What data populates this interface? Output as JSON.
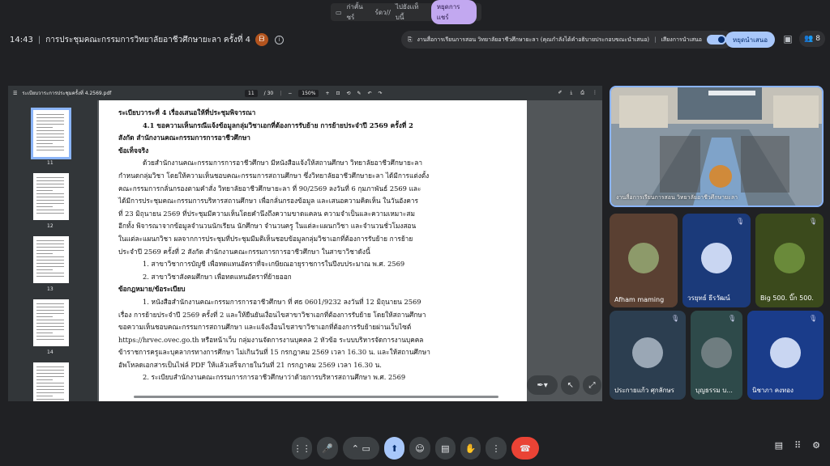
{
  "share_bar": {
    "label1": "ก่าคั้นซร์",
    "label2": "ร์ดว//",
    "label3": "ไปยังเเท็บนี้",
    "stop": "หยุดการแชร์"
  },
  "header": {
    "time": "14:43",
    "separator": "|",
    "title": "การประชุมคณะกรรมการวิทยาลัยอาชีวศึกษายะลา ครั้งที่ 4",
    "rec_glyph": "ᗷ",
    "info_glyph": "i"
  },
  "presenting": {
    "text": "งานสื่อการเรียนการสอน วิทยาลัยอาชีวศึกษายะลา (คุณกำลังได้คำอธิบายประกอบขณะนำเสนอ)",
    "audio_label": "เสียงการนำเสนอ",
    "stop_button": "หยุดนำเสนอ",
    "people_count": "8"
  },
  "pdf": {
    "filename": "ระเบียบวาระการประชุมครั้งที่ 4.2569.pdf",
    "page_current": "11",
    "page_total": "/ 30",
    "zoom": "150%",
    "thumb_labels": [
      "11",
      "12",
      "13",
      "14"
    ],
    "content": [
      {
        "cls": "b",
        "text": "ระเบียบวาระที่  4  เรื่องเสนอให้ที่ประชุมพิจารณา"
      },
      {
        "cls": "b ind",
        "text": "4.1  ขอความเห็นกรณีแจ้งข้อมูลกลุ่มวิชาเอกที่ต้องการรับย้าย การย้ายประจำปี 2569  ครั้งที่ 2"
      },
      {
        "cls": "b",
        "text": "สังกัด สำนักงานคณะกรรมการการอาชีวศึกษา"
      },
      {
        "cls": "b",
        "text": "ข้อเท็จจริง"
      },
      {
        "cls": "ind",
        "text": "ด้วยสำนักงานคณะกรรมการการอาชีวศึกษา มีหนังสือแจ้งให้สถานศึกษา วิทยาลัยอาชีวศึกษายะลา"
      },
      {
        "cls": "",
        "text": "กำหนดกลุ่มวิชา โดยให้ความเห็นชอบคณะกรรมการสถานศึกษา ซึ่งวิทยาลัยอาชีวศึกษายะลา ได้มีการแต่งตั้ง"
      },
      {
        "cls": "",
        "text": "คณะกรรมการกลั่นกรองตามคำสั่ง วิทยาลัยอาชีวศึกษายะลา ที่ 90/2569  ลงวันที่ 6 กุมภาพันธ์  2569 และ"
      },
      {
        "cls": "",
        "text": "ได้มีการประชุมคณะกรรมการบริหารสถานศึกษา เพื่อกลั่นกรองข้อมูล และเสนอความคิดเห็น ในวันอังคาร"
      },
      {
        "cls": "",
        "text": "ที่ 23  มิถุนายน  2569 ที่ประชุมมีความเห็นโดยคำนึงถึงความขาดแคลน ความจำเป็นและความเหมาะสม"
      },
      {
        "cls": "",
        "text": "อีกทั้ง พิจารณาจากข้อมูลจำนวนนักเรียน นักศึกษา จำนวนครู ในแต่ละแผนกวิชา และจำนวนชั่วโมงสอน"
      },
      {
        "cls": "",
        "text": "ในแต่ละแผนกวิชา ผลจากการประชุมที่ประชุมมีมติเห็นชอบข้อมูลกลุ่มวิชาเอกที่ต้องการรับย้าย การย้าย"
      },
      {
        "cls": "",
        "text": "ประจำปี 2569  ครั้งที่ 2  สังกัด สำนักงานคณะกรรมการการอาชีวศึกษา ในสาขาวิชาดังนี้"
      },
      {
        "cls": "ind2",
        "text": "1.   สาขาวิชาการบัญชี  เพื่อทดแทนอัตราที่จะเกษียณอายุราชการในปีงบประมาณ พ.ศ. 2569"
      },
      {
        "cls": "ind2",
        "text": "2.   สาขาวิชาสังคมศึกษา  เพื่อทดแทนอัตราที่ย้ายออก"
      },
      {
        "cls": "b",
        "text": "ข้อกฎหมาย/ข้อระเบียบ"
      },
      {
        "cls": "ind",
        "text": "1.    หนังสือสำนักงานคณะกรรมการการอาชีวศึกษา ที่ ศธ 0601/9232 ลงวันที่  12 มิถุนายน  2569"
      },
      {
        "cls": "",
        "text": "เรื่อง การย้ายประจำปี 2569 ครั้งที่ 2 และให้ยืนยันเงื่อนไขสาขาวิชาเอกที่ต้องการรับย้าย โดยให้สถานศึกษา"
      },
      {
        "cls": "",
        "text": "ขอความเห็นชอบคณะกรรมการสถานศึกษา และแจ้งเงื่อนไขสาขาวิชาเอกที่ต้องการรับย้ายผ่านเว็บไซต์"
      },
      {
        "cls": "",
        "text": "https://hrvec.ovec.go.th หรือหน้าเว็บ กลุ่มงานจัดการงานบุคคล 2 หัวข้อ ระบบบริหารจัดการงานบุคคล"
      },
      {
        "cls": "",
        "text": "ข้าราชการครูและบุคลากรทางการศึกษา ไม่เกินวันที่ 15 กรกฎาคม 2569 เวลา 16.30 น. และให้สถานศึกษา"
      },
      {
        "cls": "",
        "text": "อัพโหลดเอกสารเป็นไฟล์ PDF ให้แล้วเสร็จภายในวันที่ 21 กรกฎาคม 2569 เวลา 16.30 น."
      },
      {
        "cls": "ind",
        "text": "2.    ระเบียบสำนักงานคณะกรรมการการอาชีวศึกษาว่าด้วยการบริหารสถานศึกษา พ.ศ. 2569"
      }
    ]
  },
  "camera_tile": {
    "label": "งานสื่อการเรียนการสอน วิทยาลัยอาชีวศึกษายะลา"
  },
  "participants": [
    {
      "name": "Afham maming",
      "bg": "#5a4032",
      "avatar": "#8d9a6a"
    },
    {
      "name": "วรยุทธ์ ธีรวัฒน์",
      "bg": "#1b3a7a",
      "avatar": "#c9d6f2"
    },
    {
      "name": "Big 500. บิ๊ก 500.",
      "bg": "#3b4a1c",
      "avatar": "#6a8a3a"
    },
    {
      "name": "ประกายแก้ว ศุกลักษร",
      "bg": "#2c3e50",
      "avatar": "#9aa7b5"
    },
    {
      "name": "บุญธรรม บ...",
      "bg": "#2e4a4a",
      "avatar": "#6f7d80"
    },
    {
      "name": "นิชาภา คงทอง",
      "bg": "#1a3c8a",
      "avatar": "#c9d6f2"
    }
  ],
  "colors": {
    "accent": "#a8c7fa",
    "end_call": "#ea4335",
    "present_active": "#a8c7fa"
  }
}
